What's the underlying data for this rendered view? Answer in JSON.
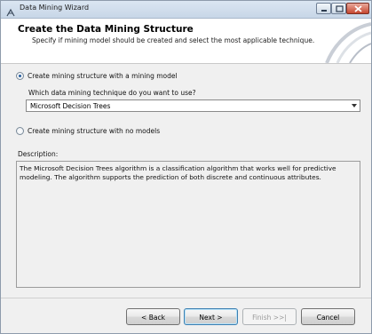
{
  "window": {
    "title": "Data Mining Wizard"
  },
  "header": {
    "title": "Create the Data Mining Structure",
    "subtitle": "Specify if mining model should be created and select the most applicable technique."
  },
  "options": {
    "with_model_label": "Create mining structure with a mining  model",
    "with_model_selected": true,
    "technique_question": "Which data mining technique do you want to use?",
    "technique_selected": "Microsoft Decision Trees",
    "no_models_label": "Create mining structure with no models",
    "no_models_selected": false
  },
  "description": {
    "label": "Description:",
    "text": "The Microsoft Decision Trees algorithm is a classification algorithm that works well for predictive modeling. The algorithm supports the prediction of both discrete and continuous attributes."
  },
  "buttons": {
    "back": "< Back",
    "next": "Next >",
    "finish": "Finish >>|",
    "cancel": "Cancel"
  }
}
